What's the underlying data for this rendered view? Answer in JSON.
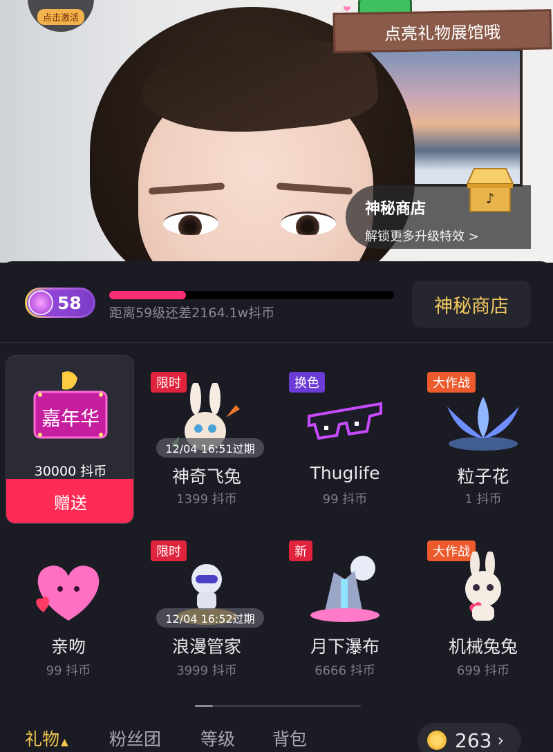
{
  "stream": {
    "activate_badge": "点击激活",
    "exhibit_banner": "点亮礼物展馆哦",
    "shop_overlay": {
      "title": "神秘商店",
      "subtitle": "解锁更多升级特效 >"
    }
  },
  "level_bar": {
    "level": "58",
    "progress_fraction": 0.27,
    "progress_text": "距离59级还差2164.1w抖币",
    "shop_button": "神秘商店"
  },
  "gifts": [
    {
      "name": "嘉年华",
      "price": "30000 抖币",
      "selected": true,
      "action": "赠送"
    },
    {
      "name": "神奇飞兔",
      "price": "1399 抖币",
      "tag": "限时",
      "tag_color": "#e1243d",
      "expire": "12/04 16:51过期"
    },
    {
      "name": "Thuglife",
      "price": "99 抖币",
      "tag": "换色",
      "tag_color": "#6b3bd6"
    },
    {
      "name": "粒子花",
      "price": "1 抖币",
      "tag": "大作战",
      "tag_color": "#ec5a2d"
    },
    {
      "name": "亲吻",
      "price": "99 抖币"
    },
    {
      "name": "浪漫管家",
      "price": "3999 抖币",
      "tag": "限时",
      "tag_color": "#e1243d",
      "expire": "12/04 16:52过期"
    },
    {
      "name": "月下瀑布",
      "price": "6666 抖币",
      "tag": "新",
      "tag_color": "#e1243d"
    },
    {
      "name": "机械兔兔",
      "price": "699 抖币",
      "tag": "大作战",
      "tag_color": "#ec5a2d"
    }
  ],
  "tabs": [
    {
      "label": "礼物",
      "active": true
    },
    {
      "label": "粉丝团"
    },
    {
      "label": "等级"
    },
    {
      "label": "背包"
    }
  ],
  "wallet": {
    "balance": "263",
    "arrow": "›"
  },
  "colors": {
    "accent": "#fe2c55",
    "gold": "#f1c95f",
    "panel": "#1b1b24"
  }
}
